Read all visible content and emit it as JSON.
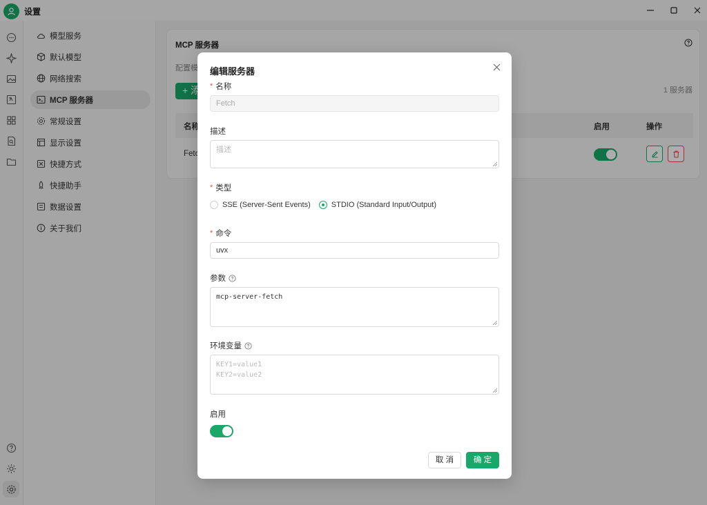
{
  "app": {
    "title": "设置"
  },
  "nav": {
    "items": [
      {
        "label": "模型服务",
        "icon": "cloud-icon"
      },
      {
        "label": "默认模型",
        "icon": "cube-icon"
      },
      {
        "label": "网络搜索",
        "icon": "globe-icon"
      },
      {
        "label": "MCP 服务器",
        "icon": "terminal-icon"
      },
      {
        "label": "常规设置",
        "icon": "gear-icon"
      },
      {
        "label": "显示设置",
        "icon": "layout-icon"
      },
      {
        "label": "快捷方式",
        "icon": "command-icon"
      },
      {
        "label": "快捷助手",
        "icon": "rocket-icon"
      },
      {
        "label": "数据设置",
        "icon": "database-icon"
      },
      {
        "label": "关于我们",
        "icon": "info-icon"
      }
    ],
    "active_index": 3
  },
  "page": {
    "title": "MCP 服务器",
    "description": "配置模",
    "add_button": "+ 添",
    "count": "1 服务器",
    "columns": {
      "name": "名称",
      "enabled": "启用",
      "actions": "操作"
    },
    "rows": [
      {
        "name": "Fetc",
        "enabled": true
      }
    ]
  },
  "dialog": {
    "title": "编辑服务器",
    "name": {
      "label": "名称",
      "value": "Fetch"
    },
    "description": {
      "label": "描述",
      "placeholder": "描述"
    },
    "type": {
      "label": "类型",
      "options": [
        {
          "label": "SSE (Server-Sent Events)",
          "checked": false
        },
        {
          "label": "STDIO (Standard Input/Output)",
          "checked": true
        }
      ]
    },
    "command": {
      "label": "命令",
      "value": "uvx"
    },
    "args": {
      "label": "参数",
      "value": "mcp-server-fetch"
    },
    "env": {
      "label": "环境变量",
      "placeholder_lines": [
        "KEY1=value1",
        "KEY2=value2"
      ]
    },
    "enable": {
      "label": "启用",
      "on": true
    },
    "cancel": "取 消",
    "ok": "确 定"
  },
  "colors": {
    "accent": "#1aa86a",
    "danger": "#e05050",
    "overlay": "rgba(0,0,0,0.32)"
  }
}
